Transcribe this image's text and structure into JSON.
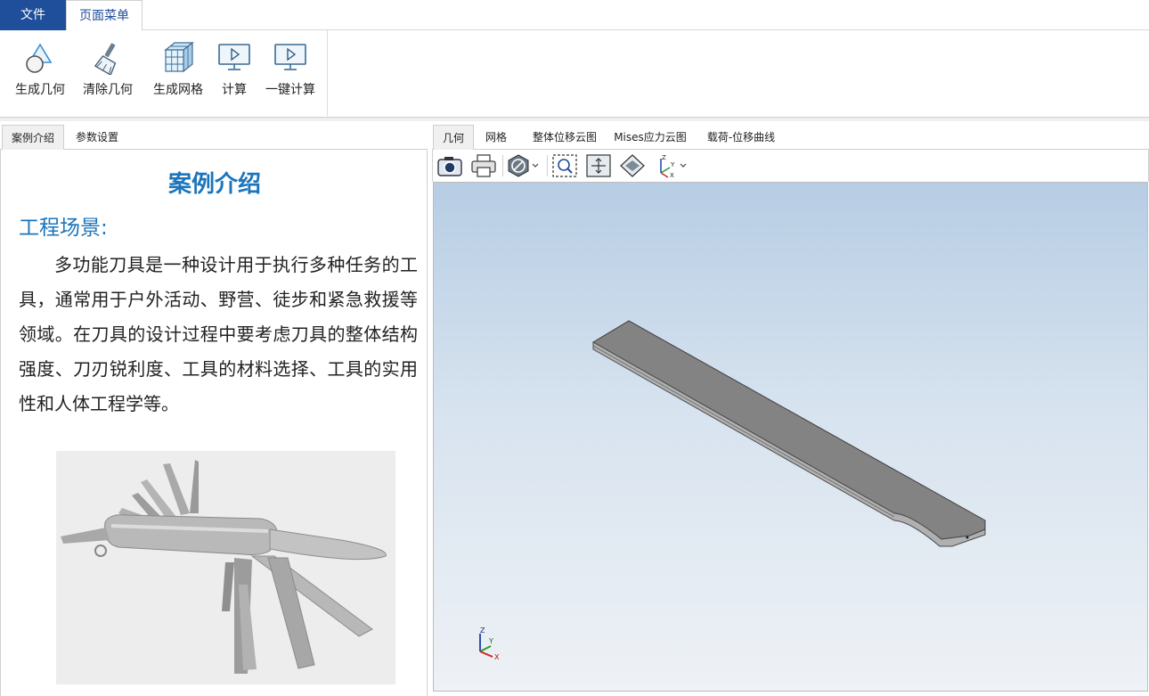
{
  "menu": {
    "file": "文件",
    "page_menu": "页面菜单"
  },
  "ribbon": {
    "buttons": [
      {
        "label": "生成几何",
        "icon": "generate-geometry-icon"
      },
      {
        "label": "清除几何",
        "icon": "clear-geometry-brush-icon"
      },
      {
        "label": "生成网格",
        "icon": "generate-mesh-cube-icon"
      },
      {
        "label": "计算",
        "icon": "compute-monitor-play-icon"
      },
      {
        "label": "一键计算",
        "icon": "one-click-compute-monitor-play-icon"
      }
    ]
  },
  "left_panel": {
    "tabs": [
      "案例介绍",
      "参数设置"
    ],
    "active_tab": "案例介绍",
    "title": "案例介绍",
    "section_title": "工程场景:",
    "paragraph": "多功能刀具是一种设计用于执行多种任务的工具，通常用于户外活动、野营、徒步和紧急救援等领域。在刀具的设计过程中要考虑刀具的整体结构强度、刀刃锐利度、工具的材料选择、工具的实用性和人体工程学等。",
    "image": "multi-tool-knife-photo"
  },
  "right_panel": {
    "tabs": [
      "几何",
      "网格",
      "整体位移云图",
      "Mises应力云图",
      "载荷-位移曲线"
    ],
    "active_tab": "几何",
    "toolbar_icons": [
      "camera-icon",
      "print-icon",
      "display-style-icon",
      "zoom-box-icon",
      "fit-all-icon",
      "isometric-view-icon",
      "axes-view-icon"
    ],
    "axis_labels": {
      "x": "X",
      "y": "Y",
      "z": "Z"
    }
  },
  "colors": {
    "menu_active_bg": "#1f4e9a",
    "title_blue": "#1b75bc",
    "viewport_top": "#b7cde4",
    "viewport_bottom": "#eef1f5",
    "part_gray": "#838383"
  }
}
